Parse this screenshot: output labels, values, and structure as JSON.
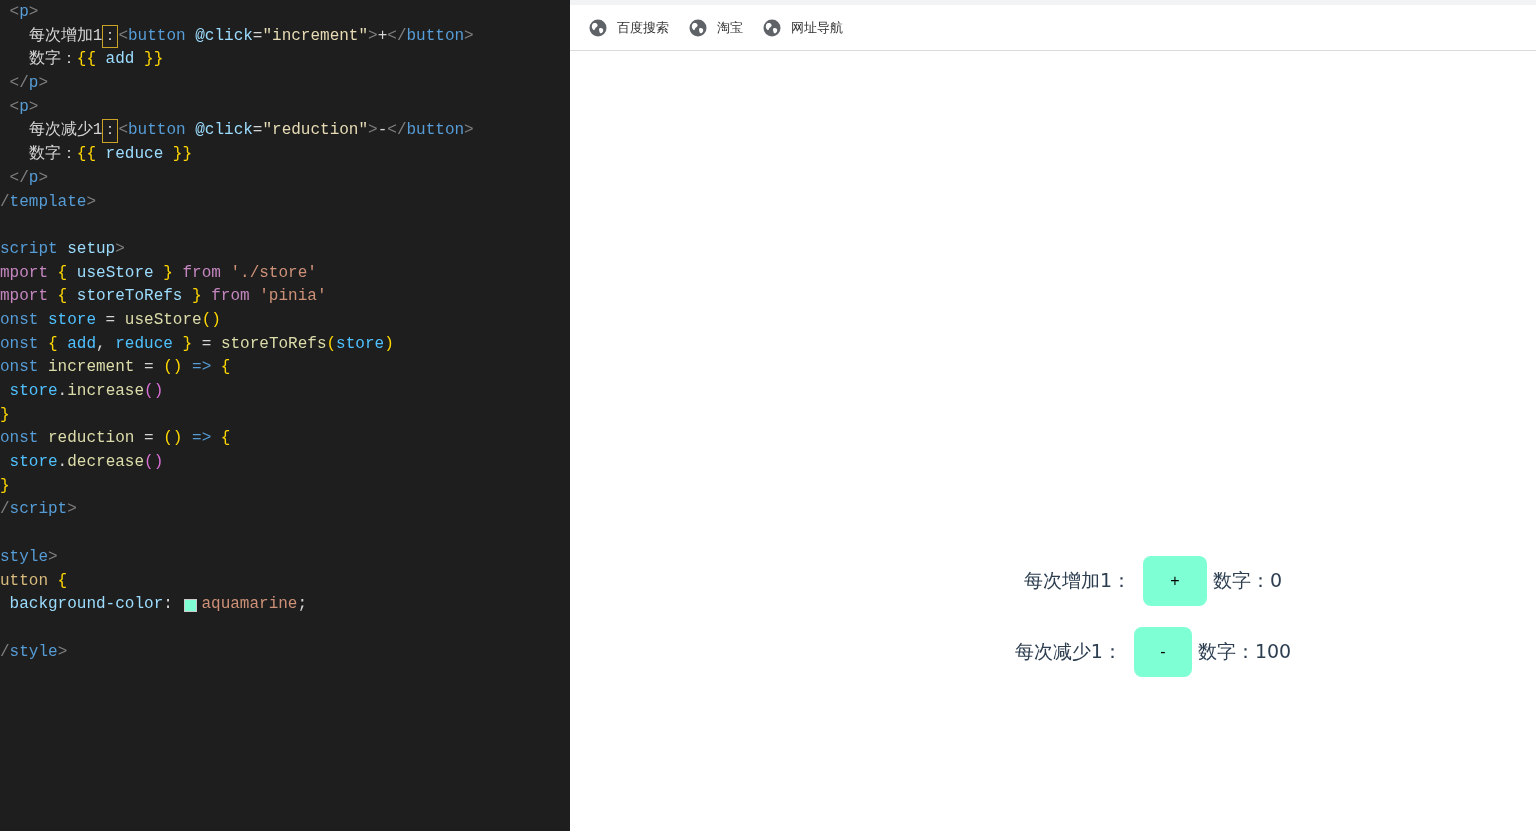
{
  "editor": {
    "lines": [
      {
        "kind": "code",
        "tokens": [
          {
            "text": " <",
            "kind": "punct"
          },
          {
            "text": "p",
            "kind": "tag"
          },
          {
            "text": ">",
            "kind": "punct"
          }
        ]
      },
      {
        "kind": "code",
        "tokens": [
          {
            "text": "   每次增加1",
            "kind": "plain"
          },
          {
            "text": "：",
            "kind": "boxed"
          },
          {
            "text": "<",
            "kind": "punct"
          },
          {
            "text": "button",
            "kind": "tag"
          },
          {
            "text": " @click",
            "kind": "attr"
          },
          {
            "text": "=",
            "kind": "plain"
          },
          {
            "text": "\"increment\"",
            "kind": "str"
          },
          {
            "text": ">",
            "kind": "punct"
          },
          {
            "text": "+",
            "kind": "plain"
          },
          {
            "text": "</",
            "kind": "punct"
          },
          {
            "text": "button",
            "kind": "tag"
          },
          {
            "text": ">",
            "kind": "punct"
          }
        ]
      },
      {
        "kind": "code",
        "tokens": [
          {
            "text": "   数字：",
            "kind": "plain"
          },
          {
            "text": "{{",
            "kind": "brace"
          },
          {
            "text": " add ",
            "kind": "var"
          },
          {
            "text": "}}",
            "kind": "brace"
          }
        ]
      },
      {
        "kind": "code",
        "tokens": [
          {
            "text": " </",
            "kind": "punct"
          },
          {
            "text": "p",
            "kind": "tag"
          },
          {
            "text": ">",
            "kind": "punct"
          }
        ]
      },
      {
        "kind": "code",
        "tokens": [
          {
            "text": " <",
            "kind": "punct"
          },
          {
            "text": "p",
            "kind": "tag"
          },
          {
            "text": ">",
            "kind": "punct"
          }
        ]
      },
      {
        "kind": "code",
        "tokens": [
          {
            "text": "   每次减少1",
            "kind": "plain"
          },
          {
            "text": "：",
            "kind": "boxed"
          },
          {
            "text": "<",
            "kind": "punct"
          },
          {
            "text": "button",
            "kind": "tag"
          },
          {
            "text": " @click",
            "kind": "attr"
          },
          {
            "text": "=",
            "kind": "plain"
          },
          {
            "text": "\"reduction\"",
            "kind": "str"
          },
          {
            "text": ">",
            "kind": "punct"
          },
          {
            "text": "-",
            "kind": "plain"
          },
          {
            "text": "</",
            "kind": "punct"
          },
          {
            "text": "button",
            "kind": "tag"
          },
          {
            "text": ">",
            "kind": "punct"
          }
        ]
      },
      {
        "kind": "code",
        "tokens": [
          {
            "text": "   数字：",
            "kind": "plain"
          },
          {
            "text": "{{",
            "kind": "brace"
          },
          {
            "text": " reduce ",
            "kind": "var"
          },
          {
            "text": "}}",
            "kind": "brace"
          }
        ]
      },
      {
        "kind": "code",
        "tokens": [
          {
            "text": " </",
            "kind": "punct"
          },
          {
            "text": "p",
            "kind": "tag"
          },
          {
            "text": ">",
            "kind": "punct"
          }
        ]
      },
      {
        "kind": "code",
        "tokens": [
          {
            "text": "/",
            "kind": "punct"
          },
          {
            "text": "template",
            "kind": "tag"
          },
          {
            "text": ">",
            "kind": "punct"
          }
        ]
      },
      {
        "kind": "blank"
      },
      {
        "kind": "code",
        "tokens": [
          {
            "text": "script",
            "kind": "tag"
          },
          {
            "text": " setup",
            "kind": "attr"
          },
          {
            "text": ">",
            "kind": "punct"
          }
        ]
      },
      {
        "kind": "code",
        "tokens": [
          {
            "text": "mport ",
            "kind": "kw"
          },
          {
            "text": "{",
            "kind": "brace"
          },
          {
            "text": " useStore ",
            "kind": "attr"
          },
          {
            "text": "}",
            "kind": "brace"
          },
          {
            "text": " from ",
            "kind": "kw"
          },
          {
            "text": "'./store'",
            "kind": "value"
          }
        ]
      },
      {
        "kind": "code",
        "tokens": [
          {
            "text": "mport ",
            "kind": "kw"
          },
          {
            "text": "{",
            "kind": "brace"
          },
          {
            "text": " storeToRefs ",
            "kind": "attr"
          },
          {
            "text": "}",
            "kind": "brace"
          },
          {
            "text": " from ",
            "kind": "kw"
          },
          {
            "text": "'pinia'",
            "kind": "value"
          }
        ]
      },
      {
        "kind": "code",
        "tokens": [
          {
            "text": "onst",
            "kind": "decl"
          },
          {
            "text": " store",
            "kind": "var2"
          },
          {
            "text": " = ",
            "kind": "plain"
          },
          {
            "text": "useStore",
            "kind": "func"
          },
          {
            "text": "()",
            "kind": "brace"
          }
        ]
      },
      {
        "kind": "code",
        "tokens": [
          {
            "text": "onst ",
            "kind": "decl"
          },
          {
            "text": "{",
            "kind": "brace"
          },
          {
            "text": " add",
            "kind": "var2"
          },
          {
            "text": ", ",
            "kind": "plain"
          },
          {
            "text": "reduce ",
            "kind": "var2"
          },
          {
            "text": "}",
            "kind": "brace"
          },
          {
            "text": " = ",
            "kind": "plain"
          },
          {
            "text": "storeToRefs",
            "kind": "func"
          },
          {
            "text": "(",
            "kind": "brace"
          },
          {
            "text": "store",
            "kind": "var2"
          },
          {
            "text": ")",
            "kind": "brace"
          }
        ]
      },
      {
        "kind": "code",
        "tokens": [
          {
            "text": "onst",
            "kind": "decl"
          },
          {
            "text": " increment",
            "kind": "func"
          },
          {
            "text": " = ",
            "kind": "plain"
          },
          {
            "text": "()",
            "kind": "brace"
          },
          {
            "text": " =>",
            "kind": "decl"
          },
          {
            "text": " {",
            "kind": "brace"
          }
        ]
      },
      {
        "kind": "code",
        "tokens": [
          {
            "text": " store",
            "kind": "var2"
          },
          {
            "text": ".",
            "kind": "plain"
          },
          {
            "text": "increase",
            "kind": "func"
          },
          {
            "text": "()",
            "kind": "paren2"
          }
        ]
      },
      {
        "kind": "code",
        "tokens": [
          {
            "text": "}",
            "kind": "brace"
          }
        ]
      },
      {
        "kind": "code",
        "tokens": [
          {
            "text": "onst",
            "kind": "decl"
          },
          {
            "text": " reduction",
            "kind": "func"
          },
          {
            "text": " = ",
            "kind": "plain"
          },
          {
            "text": "()",
            "kind": "brace"
          },
          {
            "text": " =>",
            "kind": "decl"
          },
          {
            "text": " {",
            "kind": "brace"
          }
        ]
      },
      {
        "kind": "code",
        "tokens": [
          {
            "text": " store",
            "kind": "var2"
          },
          {
            "text": ".",
            "kind": "plain"
          },
          {
            "text": "decrease",
            "kind": "func"
          },
          {
            "text": "()",
            "kind": "paren2"
          }
        ]
      },
      {
        "kind": "code",
        "tokens": [
          {
            "text": "}",
            "kind": "brace"
          }
        ]
      },
      {
        "kind": "code",
        "tokens": [
          {
            "text": "/",
            "kind": "punct"
          },
          {
            "text": "script",
            "kind": "tag"
          },
          {
            "text": ">",
            "kind": "punct"
          }
        ]
      },
      {
        "kind": "blank"
      },
      {
        "kind": "code",
        "tokens": [
          {
            "text": "style",
            "kind": "tag"
          },
          {
            "text": ">",
            "kind": "punct"
          }
        ]
      },
      {
        "kind": "code",
        "tokens": [
          {
            "text": "utton",
            "kind": "selector"
          },
          {
            "text": " {",
            "kind": "brace"
          }
        ]
      },
      {
        "kind": "code",
        "tokens": [
          {
            "text": " background-color",
            "kind": "prop"
          },
          {
            "text": ": ",
            "kind": "plain"
          },
          {
            "kind": "swatch",
            "color": "#7fffd4"
          },
          {
            "text": "aquamarine",
            "kind": "value"
          },
          {
            "text": ";",
            "kind": "plain"
          }
        ]
      },
      {
        "kind": "blank"
      },
      {
        "kind": "code",
        "tokens": [
          {
            "text": "/",
            "kind": "punct"
          },
          {
            "text": "style",
            "kind": "tag"
          },
          {
            "text": ">",
            "kind": "punct"
          }
        ]
      }
    ]
  },
  "bookmarks": [
    {
      "label": "百度搜索"
    },
    {
      "label": "淘宝"
    },
    {
      "label": "网址导航"
    }
  ],
  "page": {
    "rows": [
      {
        "label": "每次增加1：",
        "button": "+",
        "count_label": "数字：",
        "count": "0"
      },
      {
        "label": "每次减少1：",
        "button": "-",
        "count_label": "数字：",
        "count": "100"
      }
    ]
  }
}
